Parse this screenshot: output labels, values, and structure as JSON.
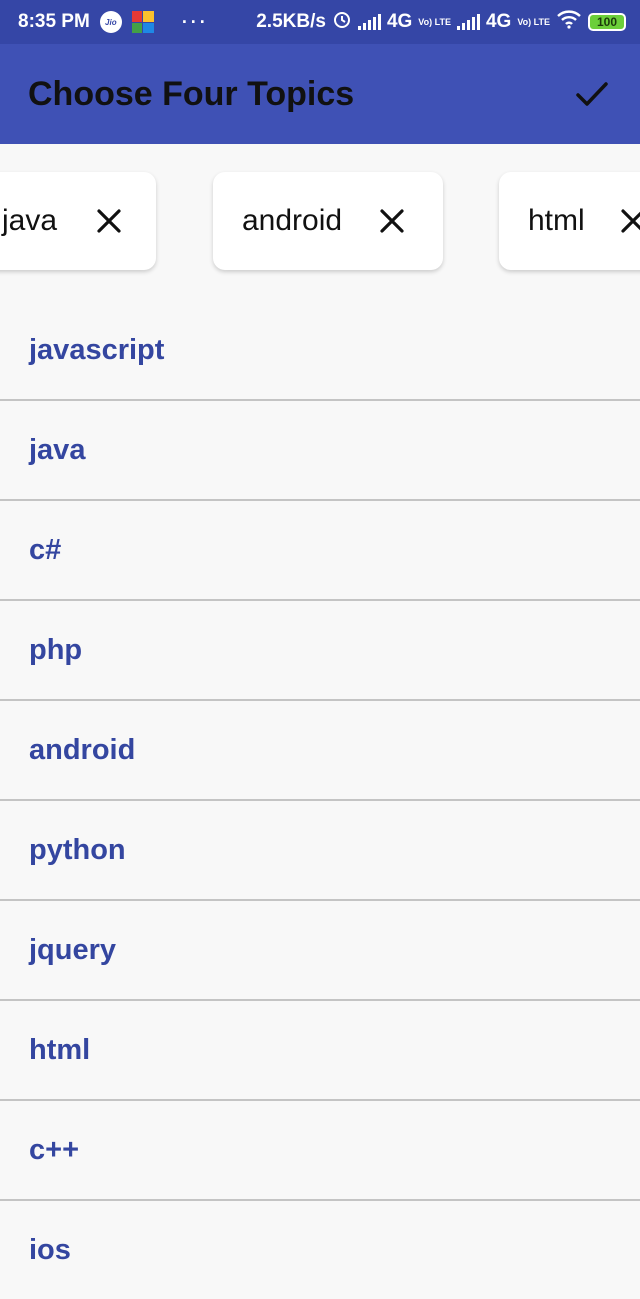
{
  "status_bar": {
    "time": "8:35 PM",
    "carrier_icon_text": "Jio",
    "more_dots": "···",
    "net_speed": "2.5KB/s",
    "network_1": "4G",
    "volte_1": "Vo) LTE",
    "network_2": "4G",
    "volte_2": "Vo) LTE",
    "battery": "100",
    "icons": [
      "jio-icon",
      "app-notification-icon",
      "alarm-icon",
      "signal-icon",
      "signal-icon",
      "wifi-icon",
      "battery-icon"
    ]
  },
  "app_bar": {
    "title": "Choose Four Topics",
    "confirm_icon": "check-icon"
  },
  "selected_chips": [
    {
      "label": "java",
      "remove_icon": "close-icon"
    },
    {
      "label": "android",
      "remove_icon": "close-icon"
    },
    {
      "label": "html",
      "remove_icon": "close-icon"
    }
  ],
  "topics": [
    "javascript",
    "java",
    "c#",
    "php",
    "android",
    "python",
    "jquery",
    "html",
    "c++",
    "ios"
  ],
  "colors": {
    "status_bar": "#3546a6",
    "app_bar": "#3f51b5",
    "topic_text": "#3446a0",
    "background": "#f8f8f8"
  }
}
